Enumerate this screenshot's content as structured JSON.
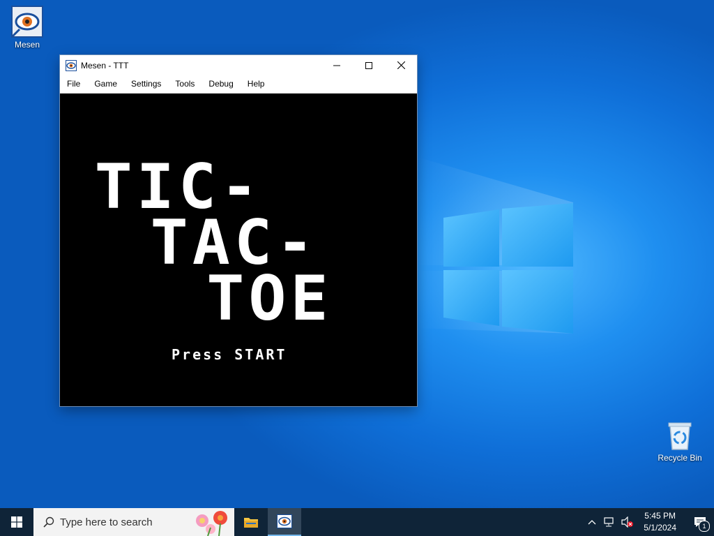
{
  "desktop": {
    "icons": [
      {
        "label": "Mesen",
        "icon": "mesen-eye-icon"
      },
      {
        "label": "Recycle Bin",
        "icon": "recycle-bin-icon"
      }
    ]
  },
  "window": {
    "title": "Mesen - TTT",
    "menu": [
      "File",
      "Game",
      "Settings",
      "Tools",
      "Debug",
      "Help"
    ],
    "controls": [
      "minimize",
      "maximize",
      "close"
    ]
  },
  "game": {
    "title_lines": [
      "TIC-",
      "TAC-",
      "TOE"
    ],
    "prompt": "Press START"
  },
  "taskbar": {
    "search_placeholder": "Type here to search",
    "time": "5:45 PM",
    "date": "5/1/2024",
    "notification_count": "1"
  },
  "colors": {
    "accent": "#0078d7",
    "taskbar": "#0f2438",
    "game_bg": "#000000",
    "game_fg": "#ffffff"
  }
}
